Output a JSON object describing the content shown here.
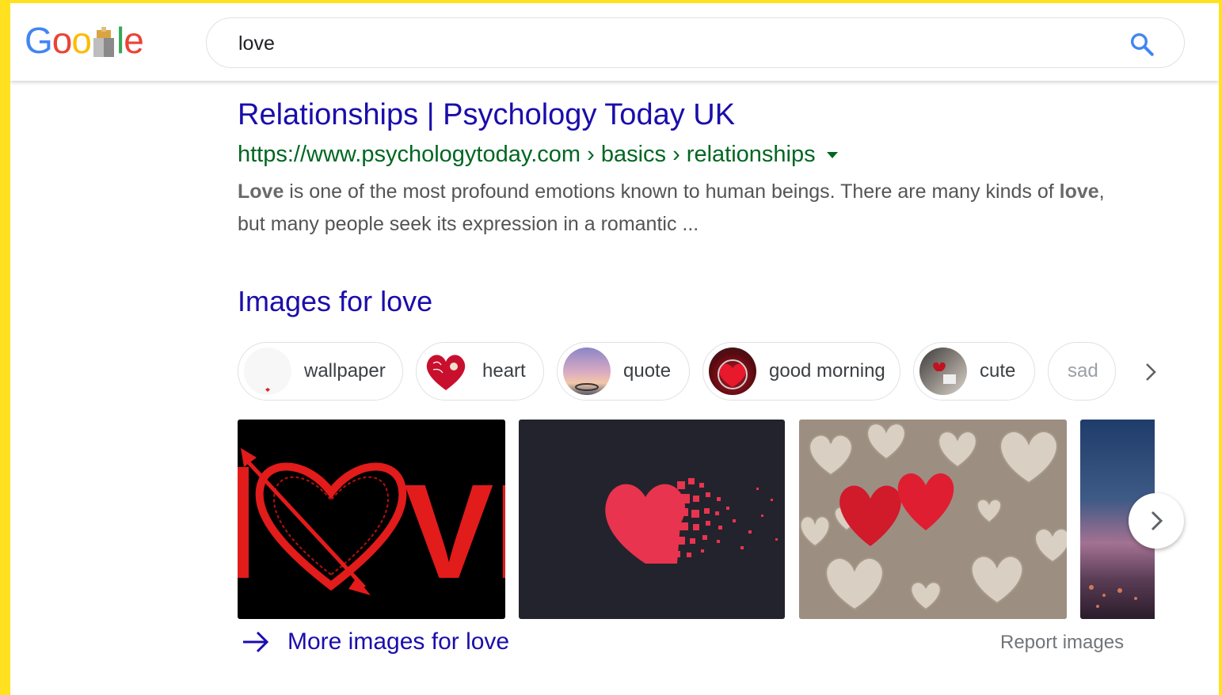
{
  "header": {
    "logo_letters": [
      "G",
      "o",
      "o",
      "l",
      "e"
    ],
    "search_value": "love"
  },
  "result": {
    "title": "Relationships | Psychology Today UK",
    "url": "https://www.psychologytoday.com › basics › relationships",
    "snippet_b1": "Love",
    "snippet_t1": " is one of the most profound emotions known to human beings. There are many kinds of ",
    "snippet_b2": "love",
    "snippet_t2": ", but many people seek its expression in a romantic ..."
  },
  "images": {
    "heading": "Images for love",
    "chips": [
      {
        "label": "wallpaper"
      },
      {
        "label": "heart"
      },
      {
        "label": "quote"
      },
      {
        "label": "good morning"
      },
      {
        "label": "cute"
      },
      {
        "label": "sad"
      }
    ],
    "tile1_text": "VE",
    "more_label": "More images for love",
    "report_label": "Report images"
  },
  "colors": {
    "frame": "#FFE11F",
    "link": "#1a0dab",
    "url_green": "#006621",
    "snippet": "#545454"
  }
}
